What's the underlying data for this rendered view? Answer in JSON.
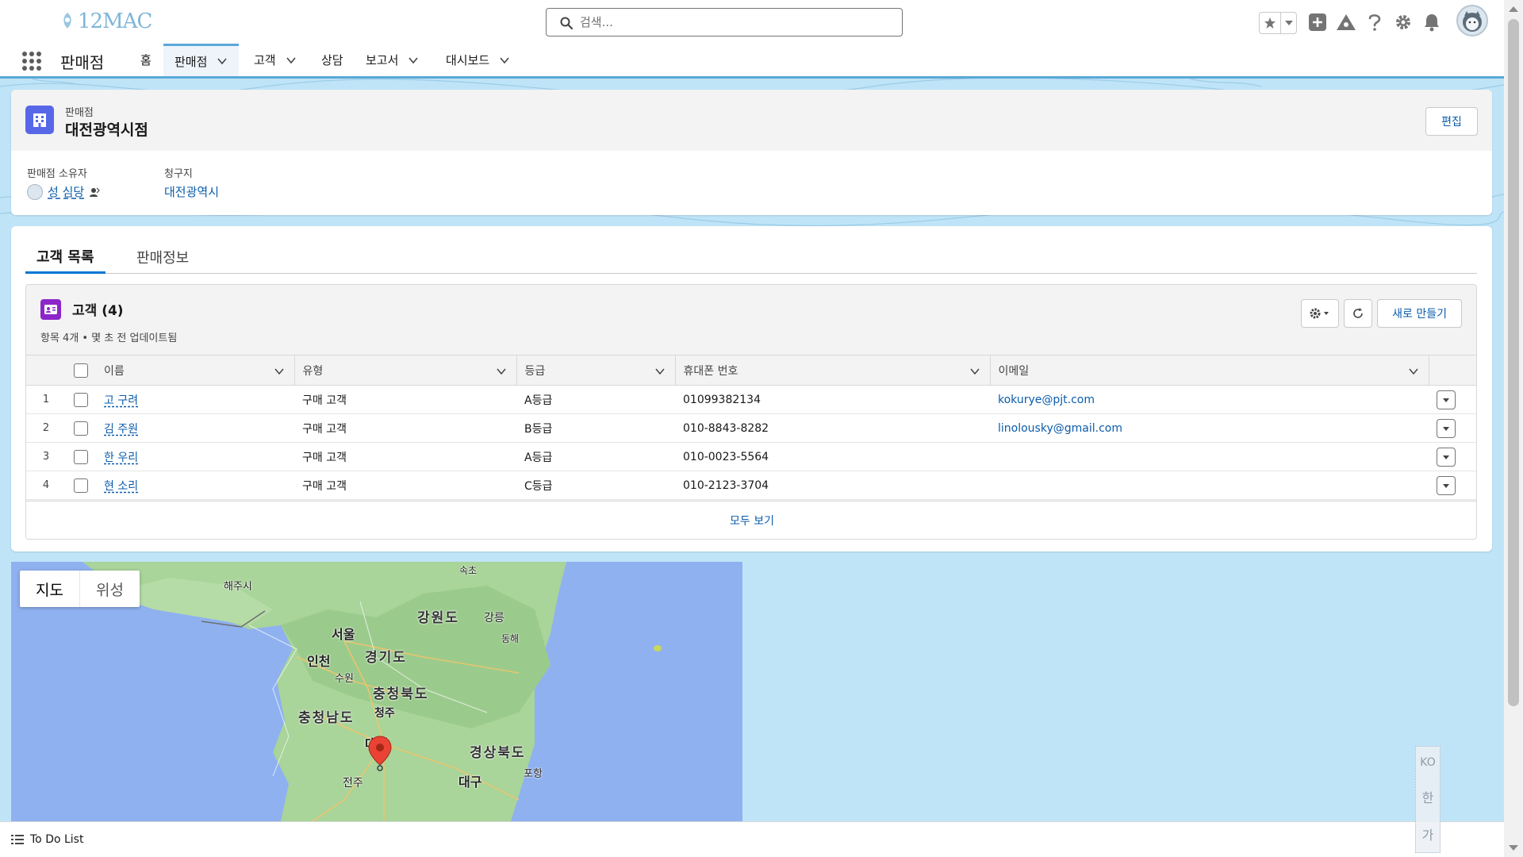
{
  "global_header": {
    "logo_text": "12MAC",
    "search_placeholder": "검색..."
  },
  "nav": {
    "app_name": "판매점",
    "items": [
      {
        "label": "홈",
        "has_menu": false,
        "active": false
      },
      {
        "label": "판매점",
        "has_menu": true,
        "active": true
      },
      {
        "label": "고객",
        "has_menu": true,
        "active": false
      },
      {
        "label": "상담",
        "has_menu": false,
        "active": false
      },
      {
        "label": "보고서",
        "has_menu": true,
        "active": false
      },
      {
        "label": "대시보드",
        "has_menu": true,
        "active": false
      }
    ]
  },
  "record": {
    "object_label": "판매점",
    "title": "대전광역시점",
    "edit_label": "편집",
    "fields": [
      {
        "label": "판매점 소유자",
        "value": "성 심당"
      },
      {
        "label": "청구지",
        "value": "대전광역시"
      }
    ]
  },
  "tabs": [
    {
      "label": "고객 목록",
      "active": true
    },
    {
      "label": "판매정보",
      "active": false
    }
  ],
  "related_list": {
    "title": "고객 (4)",
    "subtitle": "항목 4개 • 몇 초 전 업데이트됨",
    "new_label": "새로 만들기",
    "view_all": "모두 보기",
    "columns": [
      "이름",
      "유형",
      "등급",
      "휴대폰 번호",
      "이메일"
    ],
    "rows": [
      {
        "num": "1",
        "name": "고 구려",
        "type": "구매 고객",
        "grade": "A등급",
        "phone": "01099382134",
        "email": "kokurye@pjt.com"
      },
      {
        "num": "2",
        "name": "김 주원",
        "type": "구매 고객",
        "grade": "B등급",
        "phone": "010-8843-8282",
        "email": "linolousky@gmail.com"
      },
      {
        "num": "3",
        "name": "한 우리",
        "type": "구매 고객",
        "grade": "A등급",
        "phone": "010-0023-5564",
        "email": ""
      },
      {
        "num": "4",
        "name": "현 소리",
        "type": "구매 고객",
        "grade": "C등급",
        "phone": "010-2123-3704",
        "email": ""
      }
    ]
  },
  "map": {
    "type_options": [
      "지도",
      "위성"
    ],
    "labels": {
      "haeju": "해주시",
      "sokcho": "속초",
      "gangwon": "강원도",
      "gangneung": "강릉",
      "seoul": "서울",
      "donghae": "동해",
      "incheon": "인천",
      "gyeonggi": "경기도",
      "suwon": "수원",
      "chungbuk": "충청북도",
      "chungnam": "충청남도",
      "cheongju": "청주",
      "daejeon": "대전",
      "gyeongbuk": "경상북도",
      "daegu": "대구",
      "jeonju": "전주",
      "pohang": "포항"
    }
  },
  "utility_bar": {
    "todo_label": "To Do List"
  },
  "ime": {
    "mode": "KO",
    "han": "한",
    "ga": "가"
  }
}
